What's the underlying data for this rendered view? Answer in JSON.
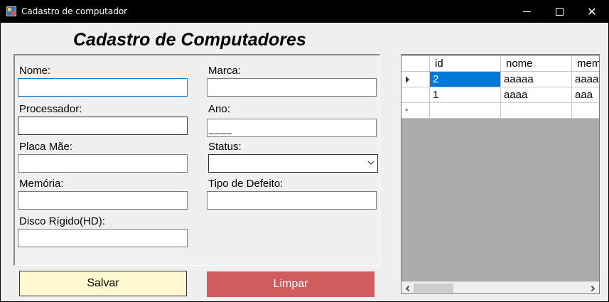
{
  "window": {
    "title": "Cadastro de computador",
    "controls": {
      "minimize": "",
      "maximize": "",
      "close": "✕"
    }
  },
  "form": {
    "heading": "Cadastro de Computadores",
    "fields": {
      "nome": {
        "label": "Nome:",
        "value": ""
      },
      "processador": {
        "label": "Processador:",
        "value": ""
      },
      "placa_mae": {
        "label": "Placa Mãe:",
        "value": ""
      },
      "memoria": {
        "label": "Memória:",
        "value": ""
      },
      "disco": {
        "label": "Disco Rígido(HD):",
        "value": ""
      },
      "marca": {
        "label": "Marca:",
        "value": ""
      },
      "ano": {
        "label": "Ano:",
        "mask": "____"
      },
      "status": {
        "label": "Status:",
        "selected": ""
      },
      "tipo_defeito": {
        "label": "Tipo de Defeito:",
        "value": ""
      }
    },
    "buttons": {
      "save": "Salvar",
      "clear": "Limpar"
    },
    "colors": {
      "save_bg": "#fff8d0",
      "clear_bg": "#d05c5b",
      "selection": "#0078d7"
    }
  },
  "grid": {
    "columns": [
      "id",
      "nome",
      "mem"
    ],
    "rows": [
      {
        "id": "2",
        "nome": "aaaaa",
        "mem": "aaaa",
        "selected": true
      },
      {
        "id": "1",
        "nome": "aaaa",
        "mem": "aaa",
        "selected": false
      }
    ],
    "new_row_marker": "*",
    "current_row_marker": "arrow-right-icon"
  }
}
